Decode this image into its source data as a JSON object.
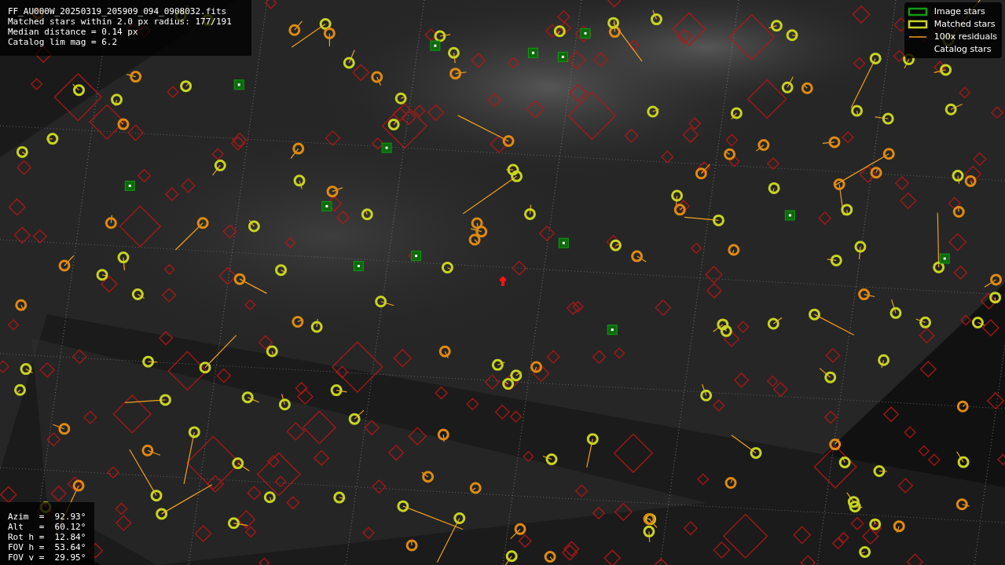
{
  "file_info": {
    "lines": [
      "FF_AU000W_20250319_205909_094_0908032.fits",
      "Matched stars within 2.0 px radius: 177/191",
      "Median distance = 0.14 px",
      "Catalog lim mag = 6.2"
    ]
  },
  "legend": {
    "items": [
      {
        "label": "Image stars"
      },
      {
        "kind": "matched",
        "label": "Matched stars"
      },
      {
        "kind": "residual",
        "label": "100x residuals"
      },
      {
        "kind": "catalog",
        "label": "Catalog stars"
      }
    ]
  },
  "pointing": {
    "lines": [
      "Azim  =  92.93°",
      "Alt   =  60.12°",
      "Rot h =  12.84°",
      "FOV h =  53.64°",
      "FOV v =  29.95°"
    ]
  }
}
